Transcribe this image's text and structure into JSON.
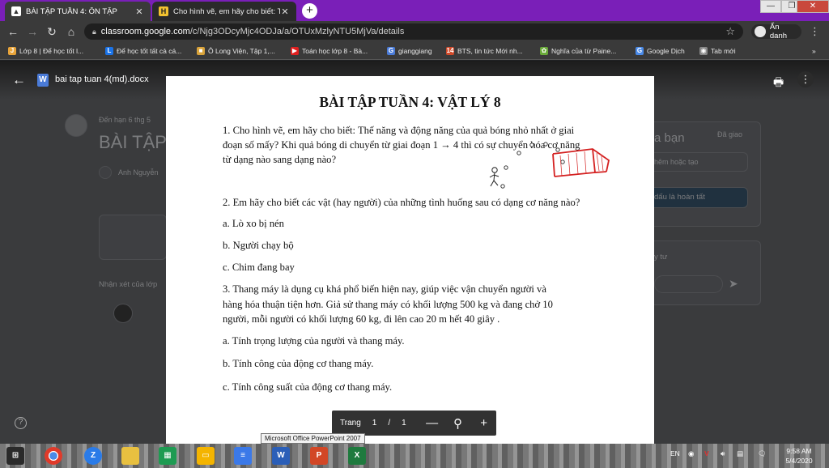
{
  "browser": {
    "tabs": [
      {
        "title": "BÀI TẬP TUẦN 4: ÔN TẬP",
        "active": true
      },
      {
        "title": "Cho hình vẽ, em hãy cho biết: Th",
        "active": false
      }
    ],
    "new_tab": "+",
    "url_host": "classroom.google.com",
    "url_path": "/c/Njg3ODcyMjc4ODJa/a/OTUxMzlyNTU5MjVa/details",
    "profile_label": "Ẩn danh",
    "bookmarks": [
      {
        "label": "Lớp 8 | Để học tốt l...",
        "color": "#e8a43a",
        "glyph": "J"
      },
      {
        "label": "Để học tốt tất cả cá...",
        "color": "#1a73e8",
        "glyph": "L"
      },
      {
        "label": "Ô Long Viện, Tập 1,...",
        "color": "#d9a33a",
        "glyph": "■"
      },
      {
        "label": "Toán học lớp 8 - Bà...",
        "color": "#e02020",
        "glyph": "▶"
      },
      {
        "label": "gianggiang",
        "color": "#4a7bd8",
        "glyph": "G"
      },
      {
        "label": "BTS, tin tức Mới nh...",
        "color": "#d04a2a",
        "glyph": "14"
      },
      {
        "label": "Nghĩa của từ Paine...",
        "color": "#6aaa3a",
        "glyph": "✿"
      },
      {
        "label": "Google Dịch",
        "color": "#4a8ae8",
        "glyph": "G"
      },
      {
        "label": "Tab mới",
        "color": "#888888",
        "glyph": "◉"
      }
    ]
  },
  "viewer": {
    "doc_title": "bai tap tuan 4(md).docx",
    "page_label": "Trang",
    "page_current": "1",
    "page_sep": "/",
    "page_total": "1",
    "tooltip": "Microsoft Office PowerPoint 2007"
  },
  "background": {
    "due": "Đến hạn 6 thg 5",
    "title": "BÀI TẬP",
    "author": "Anh Nguyễn",
    "comments": "Nhận xét của lớp",
    "your_work": "a bạn",
    "assigned": "Đã giao",
    "add_create": "hêm hoặc tạo",
    "mark_done": "dấu là hoàn tất",
    "private": "y tư"
  },
  "document": {
    "title": "BÀI TẬP TUẦN 4: VẬT LÝ 8",
    "q1_line1": "1. Cho hình vẽ, em hãy cho biết: Thế năng và động năng của quả bóng nhỏ nhất ở giai",
    "q1_line2": "đoạn số mấy? Khi quả bóng di chuyển từ giai đoạn 1 → 4 thì có sự chuyển hóa cơ năng",
    "q1_line3": "từ dạng nào sang dạng nào?",
    "q2": "2. Em hãy cho biết các vật (hay người) của những tình huống sau có dạng cơ năng nào?",
    "q2a": "a. Lò xo bị nén",
    "q2b": "b. Người chạy bộ",
    "q2c": "c. Chim đang bay",
    "q3_line1": "3. Thang máy là dụng cụ khá phổ biến hiện nay, giúp việc vận chuyển người và",
    "q3_line2": "hàng hóa thuận tiện hơn. Giả sử thang máy có khối lượng 500 kg và đang chở 10",
    "q3_line3": "người, mỗi người có khối lượng 60 kg, đi lên cao 20 m hết 40 giây .",
    "q3a": "a. Tính trọng lượng của người và thang máy.",
    "q3b": "b. Tính công của động cơ thang máy.",
    "q3c": "c. Tính công suất của động cơ thang máy."
  },
  "taskbar": {
    "lang": "EN",
    "time": "9:58 AM",
    "date": "5/4/2020"
  }
}
